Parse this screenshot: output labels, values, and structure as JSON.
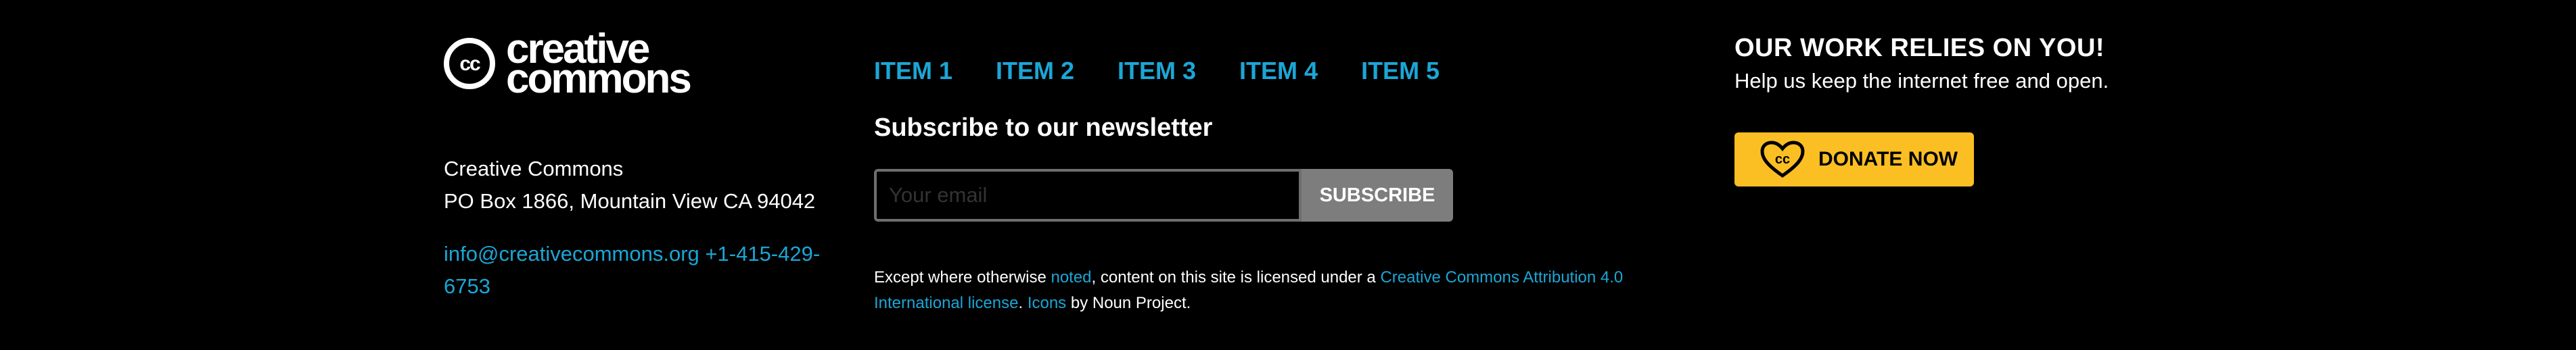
{
  "brand": {
    "line1": "creative",
    "line2": "commons",
    "badge": "cc"
  },
  "address": {
    "name": "Creative Commons",
    "street": "PO Box 1866, Mountain View CA 94042"
  },
  "contact": {
    "email": "info@creativecommons.org",
    "phone": "+1-415-429-6753"
  },
  "nav": {
    "items": [
      "ITEM 1",
      "ITEM 2",
      "ITEM 3",
      "ITEM 4",
      "ITEM 5"
    ]
  },
  "newsletter": {
    "title": "Subscribe to our newsletter",
    "placeholder": "Your email",
    "button": "SUBSCRIBE"
  },
  "license": {
    "t1": "Except where otherwise ",
    "l1": "noted",
    "t2": ", content on this site is licensed under a ",
    "l2": "Creative Commons Attribution 4.0 International license",
    "t3": ". ",
    "l3": "Icons",
    "t4": " by Noun Project."
  },
  "support": {
    "title": "OUR WORK RELIES ON YOU!",
    "text": "Help us keep the internet free and open.",
    "donate": "DONATE NOW"
  },
  "colors": {
    "background": "#000000",
    "link": "#1ba6d6",
    "donate": "#fbbf24",
    "subscribe": "#7d7d7d"
  }
}
